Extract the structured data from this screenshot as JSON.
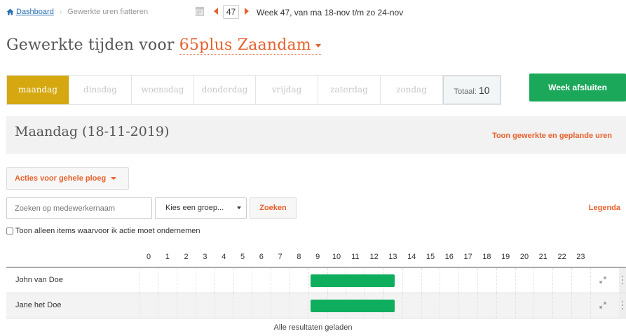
{
  "breadcrumb": {
    "home": "Dashboard",
    "current": "Gewerkte uren fiatteren"
  },
  "week": {
    "number": "47",
    "label": "Week 47, van ma 18-nov t/m zo 24-nov"
  },
  "title": {
    "prefix": "Gewerkte tijden voor",
    "organization": "65plus Zaandam"
  },
  "tabs": [
    {
      "label": "maandag",
      "active": true
    },
    {
      "label": "dinsdag"
    },
    {
      "label": "woensdag"
    },
    {
      "label": "donderdag"
    },
    {
      "label": "vrijdag"
    },
    {
      "label": "zaterdag"
    },
    {
      "label": "zondag"
    }
  ],
  "total": {
    "label": "Totaal:",
    "value": "10"
  },
  "close_week_label": "Week afsluiten",
  "day": {
    "title": "Maandag (18-11-2019)",
    "link": "Toon gewerkte en geplande uren"
  },
  "actions_label": "Acties voor gehele ploeg",
  "search": {
    "placeholder": "Zoeken op medewerkernaam",
    "group_value": "Kies een groep...",
    "button": "Zoeken"
  },
  "legend_label": "Legenda",
  "checkbox_label": "Toon alleen items waarvoor ik actie moet ondernemen",
  "hours": [
    "0",
    "1",
    "2",
    "3",
    "4",
    "5",
    "6",
    "7",
    "8",
    "9",
    "10",
    "11",
    "12",
    "13",
    "14",
    "15",
    "16",
    "17",
    "18",
    "19",
    "20",
    "21",
    "22",
    "23"
  ],
  "employees": [
    {
      "name": "John van Doe",
      "start": 9,
      "end": 14
    },
    {
      "name": "Jane het Doe",
      "start": 9,
      "end": 14
    }
  ],
  "colors": {
    "accent": "#e8602c",
    "active_tab": "#d4a80e",
    "bar": "#0fae5e",
    "close_button": "#1ca85b"
  },
  "footer_text": "Alle resultaten geladen"
}
